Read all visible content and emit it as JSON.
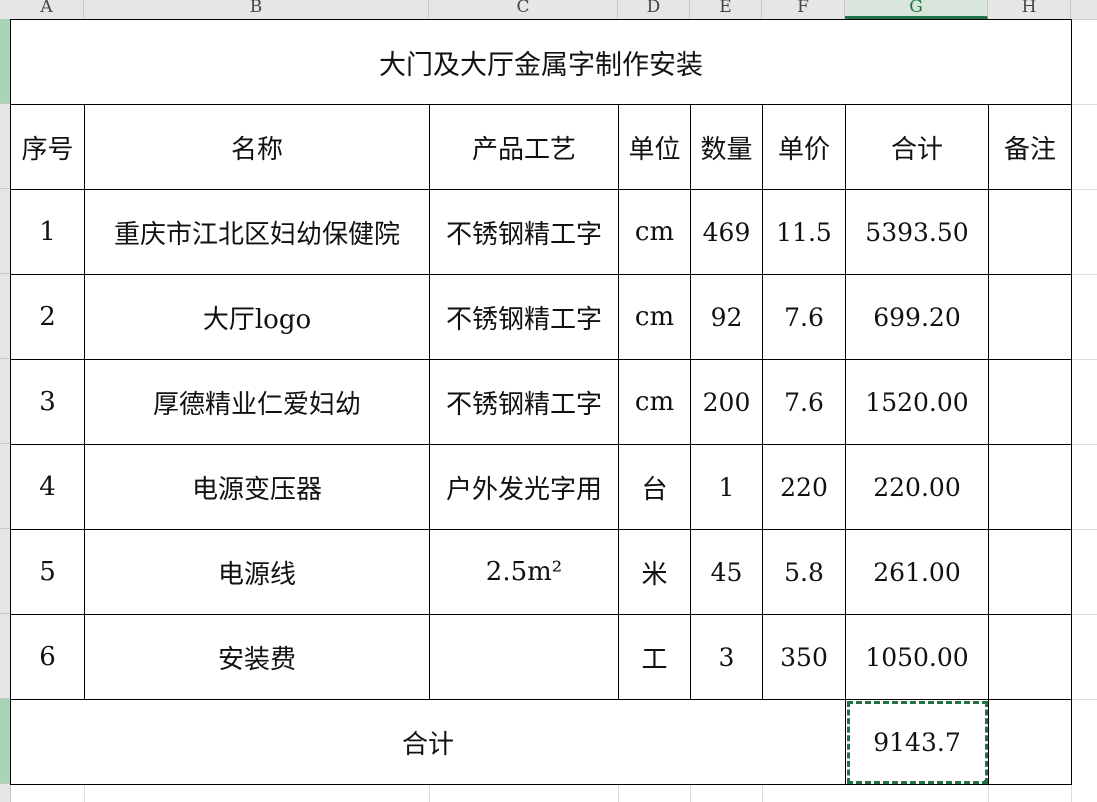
{
  "columns": [
    {
      "letter": "A",
      "active": false
    },
    {
      "letter": "B",
      "active": false
    },
    {
      "letter": "C",
      "active": false
    },
    {
      "letter": "D",
      "active": false
    },
    {
      "letter": "E",
      "active": false
    },
    {
      "letter": "F",
      "active": false
    },
    {
      "letter": "G",
      "active": true
    },
    {
      "letter": "H",
      "active": false
    }
  ],
  "title": "大门及大厅金属字制作安装",
  "headers": [
    "序号",
    "名称",
    "产品工艺",
    "单位",
    "数量",
    "单价",
    "合计",
    "备注"
  ],
  "rows": [
    [
      "1",
      "重庆市江北区妇幼保健院",
      "不锈钢精工字",
      "cm",
      "469",
      "11.5",
      "5393.50",
      ""
    ],
    [
      "2",
      "大厅logo",
      "不锈钢精工字",
      "cm",
      "92",
      "7.6",
      "699.20",
      ""
    ],
    [
      "3",
      "厚德精业仁爱妇幼",
      "不锈钢精工字",
      "cm",
      "200",
      "7.6",
      "1520.00",
      ""
    ],
    [
      "4",
      "电源变压器",
      "户外发光字用",
      "台",
      "1",
      "220",
      "220.00",
      ""
    ],
    [
      "5",
      "电源线",
      "2.5m²",
      "米",
      "45",
      "5.8",
      "261.00",
      ""
    ],
    [
      "6",
      "安装费",
      "",
      "工",
      "3",
      "350",
      "1050.00",
      ""
    ]
  ],
  "total": {
    "label": "合计",
    "value": "9143.7",
    "note": ""
  },
  "colors": {
    "selection": "#217346",
    "header_bg": "#e6e6e6",
    "grid": "#000000"
  }
}
